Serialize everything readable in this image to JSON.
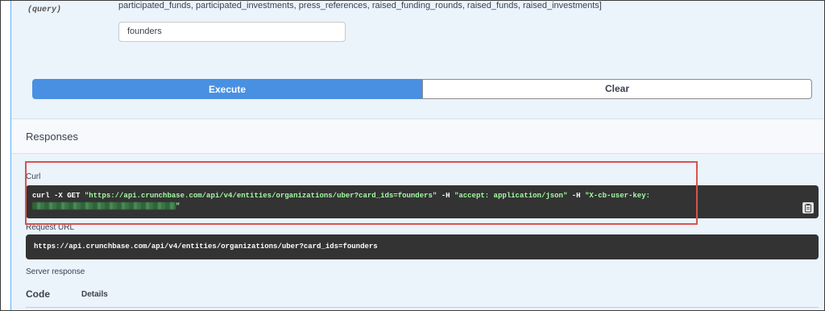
{
  "parameter": {
    "label": "(query)",
    "enum_text": "participated_funds, participated_investments, press_references, raised_funding_rounds, raised_funds, raised_investments]",
    "input_value": "founders"
  },
  "buttons": {
    "execute_label": "Execute",
    "clear_label": "Clear"
  },
  "responses": {
    "title": "Responses",
    "curl_label": "Curl",
    "curl": {
      "cmd": "curl -X GET",
      "url": "\"https://api.crunchbase.com/api/v4/entities/organizations/uber?card_ids=founders\"",
      "h1_flag": "-H",
      "h1_value": "\"accept: application/json\"",
      "h2_flag": "-H",
      "h2_value": "\"X-cb-user-key:",
      "closing_quote": "\""
    },
    "request_url_label": "Request URL",
    "request_url": "https://api.crunchbase.com/api/v4/entities/organizations/uber?card_ids=founders",
    "server_response_label": "Server response",
    "code_header": "Code",
    "details_header": "Details"
  },
  "colors": {
    "execute": "#4990e2",
    "code_bg": "#333333",
    "string_green": "#a2fca2",
    "highlight_red": "#d9534f",
    "panel_bg": "#ebf3fb"
  },
  "icons": {
    "copy": "clipboard-copy-icon"
  }
}
